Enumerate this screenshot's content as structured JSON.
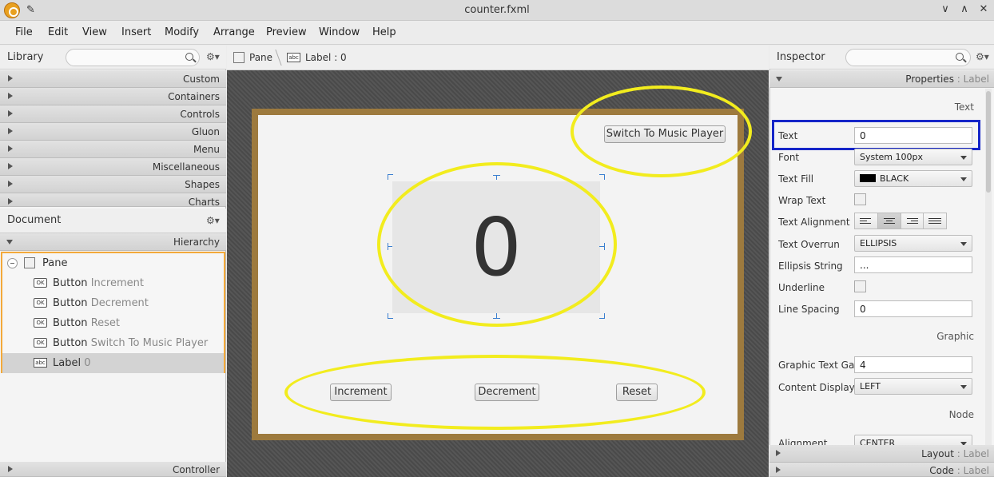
{
  "window": {
    "title": "counter.fxml"
  },
  "menu": [
    "File",
    "Edit",
    "View",
    "Insert",
    "Modify",
    "Arrange",
    "Preview",
    "Window",
    "Help"
  ],
  "library": {
    "title": "Library",
    "search_placeholder": "",
    "categories": [
      "Custom",
      "Containers",
      "Controls",
      "Gluon",
      "Menu",
      "Miscellaneous",
      "Shapes",
      "Charts"
    ]
  },
  "document": {
    "title": "Document",
    "hierarchy_label": "Hierarchy",
    "items": [
      {
        "type": "Pane",
        "text": ""
      },
      {
        "type": "Button",
        "text": "Increment"
      },
      {
        "type": "Button",
        "text": "Decrement"
      },
      {
        "type": "Button",
        "text": "Reset"
      },
      {
        "type": "Button",
        "text": "Switch To Music Player"
      },
      {
        "type": "Label",
        "text": "0"
      }
    ],
    "controller_label": "Controller"
  },
  "breadcrumb": {
    "pane": "Pane",
    "label": "Label : 0"
  },
  "canvas": {
    "label_text": "0",
    "buttons": {
      "increment": "Increment",
      "decrement": "Decrement",
      "reset": "Reset",
      "switch": "Switch To Music Player"
    }
  },
  "inspector": {
    "title": "Inspector",
    "properties_header": "Properties",
    "properties_sub": " : Label",
    "sections": {
      "text": "Text",
      "graphic": "Graphic",
      "node": "Node"
    },
    "props": {
      "text_label": "Text",
      "text_value": "0",
      "font_label": "Font",
      "font_value": "System 100px",
      "fill_label": "Text Fill",
      "fill_value": "BLACK",
      "wrap_label": "Wrap Text",
      "align_label": "Text Alignment",
      "overrun_label": "Text Overrun",
      "overrun_value": "ELLIPSIS",
      "ellipsis_label": "Ellipsis String",
      "ellipsis_value": "...",
      "underline_label": "Underline",
      "spacing_label": "Line Spacing",
      "spacing_value": "0",
      "gap_label": "Graphic Text Gap",
      "gap_value": "4",
      "display_label": "Content Display",
      "display_value": "LEFT",
      "alignment_label": "Alignment",
      "alignment_value": "CENTER"
    },
    "layout_header": "Layout",
    "layout_sub": " : Label",
    "code_header": "Code",
    "code_sub": " : Label"
  },
  "colors": {
    "highlight": "#f2ec1e",
    "selection_box": "#1525c8",
    "hierarchy_border": "#f3a93a"
  }
}
